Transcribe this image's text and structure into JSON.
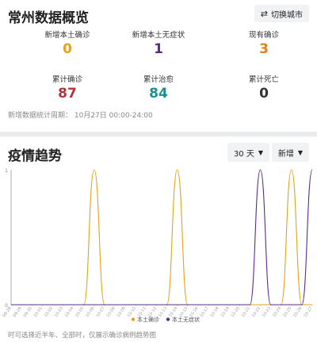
{
  "overview": {
    "title": "常州数据概览",
    "switch_label": "切换城市",
    "stats": [
      {
        "label": "新增本土确诊",
        "value": "0",
        "color": "#e6a116"
      },
      {
        "label": "新增本土无症状",
        "value": "1",
        "color": "#5b2a8e"
      },
      {
        "label": "现有确诊",
        "value": "3",
        "color": "#e0801e"
      },
      {
        "label": "累计确诊",
        "value": "87",
        "color": "#b5343c"
      },
      {
        "label": "累计治愈",
        "value": "84",
        "color": "#1d8f8f"
      },
      {
        "label": "累计死亡",
        "value": "0",
        "color": "#333333"
      }
    ],
    "stat_date": "新增数据统计周期： 10月27日 00:00-24:00"
  },
  "trend": {
    "title": "疫情趋势",
    "range_label": "30 天",
    "type_label": "新增",
    "footnote": "时可选择近半年、全部时，仅展示确诊病例趋势图"
  },
  "chart_data": {
    "type": "line",
    "y_tick_labels": [
      "0",
      "1"
    ],
    "ylim": [
      0,
      1
    ],
    "x": [
      "09-28",
      "09-29",
      "09-30",
      "10-01",
      "10-02",
      "10-03",
      "10-04",
      "10-05",
      "10-06",
      "10-07",
      "10-08",
      "10-09",
      "10-10",
      "10-11",
      "10-12",
      "10-13",
      "10-14",
      "10-15",
      "10-16",
      "10-17",
      "10-18",
      "10-19",
      "10-20",
      "10-21",
      "10-22",
      "10-23",
      "10-24",
      "10-25",
      "10-26",
      "10-27"
    ],
    "series": [
      {
        "name": "本土确诊",
        "color": "#e6a116",
        "values": [
          0,
          0,
          0,
          0,
          0,
          0,
          0,
          0,
          1,
          0,
          0,
          0,
          0,
          0,
          0,
          0,
          1,
          0,
          0,
          0,
          0,
          0,
          0,
          0,
          0,
          0,
          0,
          1,
          0,
          0
        ]
      },
      {
        "name": "本土无症状",
        "color": "#5b2a8e",
        "values": [
          0,
          0,
          0,
          0,
          0,
          0,
          0,
          0,
          0,
          0,
          0,
          0,
          0,
          0,
          0,
          0,
          0,
          0,
          0,
          0,
          0,
          0,
          0,
          0,
          1,
          0,
          0,
          0,
          0,
          1
        ]
      }
    ],
    "legend_position": "bottom-center"
  }
}
